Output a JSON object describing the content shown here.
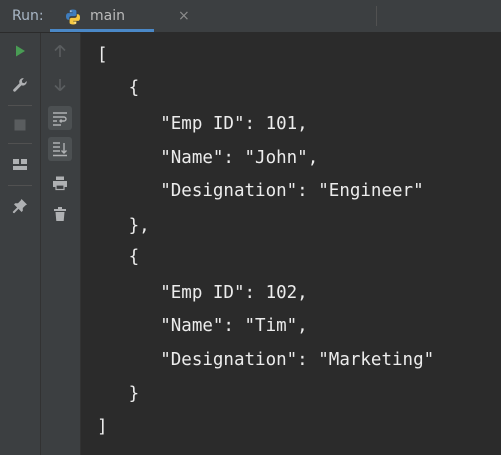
{
  "run_panel": {
    "label": "Run:",
    "tab": {
      "name": "main",
      "icon": "python-icon",
      "close_glyph": "×"
    }
  },
  "toolbar_left": [
    {
      "name": "rerun-icon",
      "color": "#499c54"
    },
    {
      "name": "wrench-icon",
      "color": "#afb1b3"
    },
    {
      "name": "stop-icon",
      "color": "#5a5d5f"
    },
    {
      "name": "layout-icon",
      "color": "#afb1b3"
    },
    {
      "name": "pin-icon",
      "color": "#afb1b3"
    }
  ],
  "toolbar_right": [
    {
      "name": "up-arrow-icon",
      "color": "#5a5d5f"
    },
    {
      "name": "down-arrow-icon",
      "color": "#5a5d5f"
    },
    {
      "name": "soft-wrap-icon",
      "color": "#afb1b3"
    },
    {
      "name": "scroll-to-end-icon",
      "color": "#afb1b3"
    },
    {
      "name": "print-icon",
      "color": "#afb1b3"
    },
    {
      "name": "trash-icon",
      "color": "#afb1b3"
    }
  ],
  "console": {
    "lines": [
      "[",
      "   {",
      "      \"Emp ID\": 101,",
      "      \"Name\": \"John\",",
      "      \"Designation\": \"Engineer\"",
      "   },",
      "   {",
      "      \"Emp ID\": 102,",
      "      \"Name\": \"Tim\",",
      "      \"Designation\": \"Marketing\"",
      "   }",
      "]"
    ]
  }
}
